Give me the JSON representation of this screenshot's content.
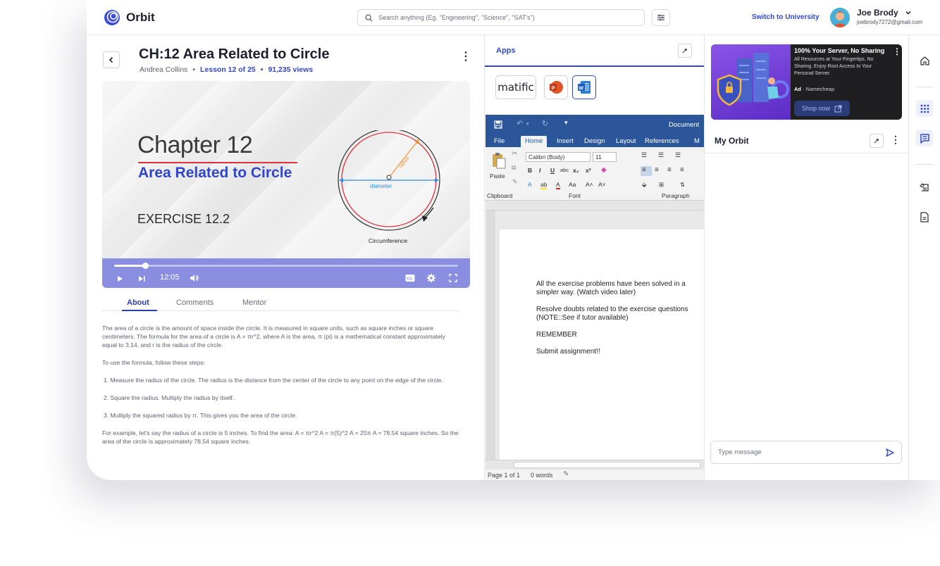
{
  "header": {
    "brand": "Orbit",
    "search_placeholder": "Search anything (Eg. \"Engineering\", \"Science\", \"SAT's\")",
    "switch_label": "Switch to University",
    "user_name": "Joe Brody",
    "user_email": "joebrody7272@gmail.com"
  },
  "lesson": {
    "title": "CH:12 Area Related to Circle",
    "author": "Andrea Collins",
    "lesson_progress": "Lesson 12 of 25",
    "views": "91,235 views"
  },
  "video": {
    "slide_title": "Chapter 12",
    "slide_subtitle": "Area Related to Circle",
    "slide_exercise": "EXERCISE 12.2",
    "label_radius": "radius",
    "label_diameter": "diameter",
    "label_circumference": "Circumference",
    "time": "12:05",
    "progress_fraction": 0.09
  },
  "tabs": [
    "About",
    "Comments",
    "Mentor"
  ],
  "about": {
    "p1": "The area of a circle is the amount of space inside the circle. It is measured in square units, such as square inches or square centimeters. The formula for the area of a circle is A = πr^2, where A is the area, π (pi) is a mathematical constant approximately equal to 3.14, and r is the radius of the circle.",
    "p2": "To use the formula, follow these steps:",
    "step1": "1. Measure the radius of the circle. The radius is the distance from the center of the circle to any point on the edge of the circle.",
    "step2": "2. Square the radius. Multiply the radius by itself.",
    "step3": "3. Multiply the squared radius by π. This gives you the area of the circle.",
    "p3": "For example, let's say the radius of a circle is 5 inches. To find the area: A = πr^2 A = π(5)^2 A = 25π A ≈ 78.54 square inches. So the area of the circle is approximately 78.54 square inches."
  },
  "apps": {
    "heading": "Apps",
    "app1": "matific"
  },
  "word": {
    "doc_title": "Document",
    "menu": [
      "File",
      "Home",
      "Insert",
      "Design",
      "Layout",
      "References",
      "M"
    ],
    "font_name": "Calibri (Body)",
    "font_size": "11",
    "paste": "Paste",
    "groups": [
      "Clipboard",
      "Font",
      "Paragraph"
    ],
    "lines": [
      "All the exercise problems have been solved in a simpler way. (Watch video later)",
      "Resolve doubts related to the exercise questions (NOTE::See if tutor available)",
      "REMEMBER",
      "Submit assignment!!"
    ],
    "status_page": "Page 1 of 1",
    "status_words": "0 words"
  },
  "ad": {
    "headline": "100% Your Server, No Sharing",
    "text": "All Resources at Your Fingertips, No Sharing. Enjoy Root Access to Your Personal Server.",
    "ad_label": "Ad",
    "advertiser": "Namecheap",
    "cta": "Shop now"
  },
  "chat": {
    "title": "My Orbit",
    "placeholder": "Type message"
  },
  "colors": {
    "brand": "#3048c8",
    "video_controls": "#8a8ee0",
    "word_blue": "#2b579a"
  }
}
